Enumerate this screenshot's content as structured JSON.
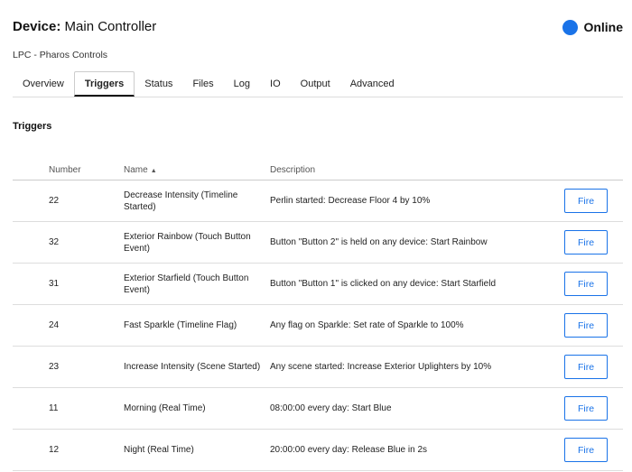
{
  "header": {
    "device_label": "Device:",
    "device_name": "Main Controller",
    "status": "Online",
    "status_color": "#1a73e8"
  },
  "subtitle": "LPC - Pharos Controls",
  "tabs": [
    "Overview",
    "Triggers",
    "Status",
    "Files",
    "Log",
    "IO",
    "Output",
    "Advanced"
  ],
  "active_tab": "Triggers",
  "section_title": "Triggers",
  "table": {
    "columns": {
      "number": "Number",
      "name": "Name",
      "description": "Description",
      "sort_icon": "sort-ascending-icon"
    },
    "rows": [
      {
        "number": "22",
        "name": "Decrease Intensity (Timeline Started)",
        "description": "Perlin started: Decrease Floor 4 by 10%",
        "action": "Fire"
      },
      {
        "number": "32",
        "name": "Exterior Rainbow (Touch Button Event)",
        "description": "Button \"Button 2\" is held on any device: Start Rainbow",
        "action": "Fire"
      },
      {
        "number": "31",
        "name": "Exterior Starfield (Touch Button Event)",
        "description": "Button \"Button 1\" is clicked on any device: Start Starfield",
        "action": "Fire"
      },
      {
        "number": "24",
        "name": "Fast Sparkle (Timeline Flag)",
        "description": "Any flag on Sparkle: Set rate of Sparkle to 100%",
        "action": "Fire"
      },
      {
        "number": "23",
        "name": "Increase Intensity (Scene Started)",
        "description": "Any scene started: Increase Exterior Uplighters by 10%",
        "action": "Fire"
      },
      {
        "number": "11",
        "name": "Morning (Real Time)",
        "description": "08:00:00 every day: Start Blue",
        "action": "Fire"
      },
      {
        "number": "12",
        "name": "Night (Real Time)",
        "description": "20:00:00 every day: Release Blue in 2s",
        "action": "Fire"
      }
    ]
  }
}
